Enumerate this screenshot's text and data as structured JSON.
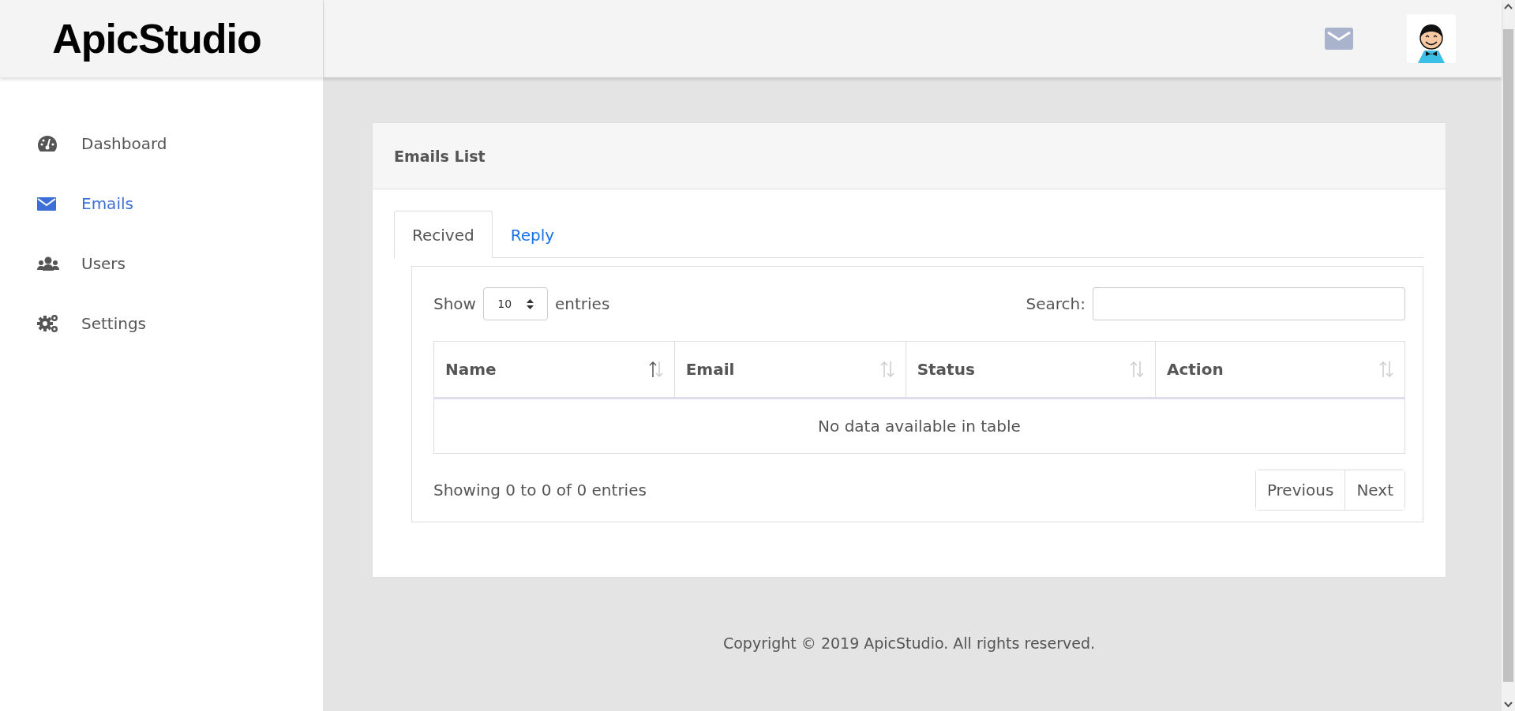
{
  "header": {
    "logo": "ApicStudio"
  },
  "sidebar": {
    "items": [
      {
        "label": "Dashboard",
        "selected": false
      },
      {
        "label": "Emails",
        "selected": true
      },
      {
        "label": "Users",
        "selected": false
      },
      {
        "label": "Settings",
        "selected": false
      }
    ]
  },
  "card": {
    "title": "Emails List",
    "tabs": [
      {
        "label": "Recived",
        "selected": true
      },
      {
        "label": "Reply",
        "selected": false
      }
    ],
    "length_menu": {
      "before": "Show",
      "value": "10",
      "after": "entries"
    },
    "search": {
      "label": "Search:"
    },
    "table": {
      "columns": [
        {
          "label": "Name",
          "sorted": true
        },
        {
          "label": "Email",
          "sorted": false
        },
        {
          "label": "Status",
          "sorted": false
        },
        {
          "label": "Action",
          "sorted": false
        }
      ],
      "empty_message": "No data available in table"
    },
    "info": "Showing 0 to 0 of 0 entries",
    "pagination": [
      "Previous",
      "Next"
    ]
  },
  "footer": {
    "text": "Copyright © 2019 ApicStudio. All rights reserved."
  }
}
